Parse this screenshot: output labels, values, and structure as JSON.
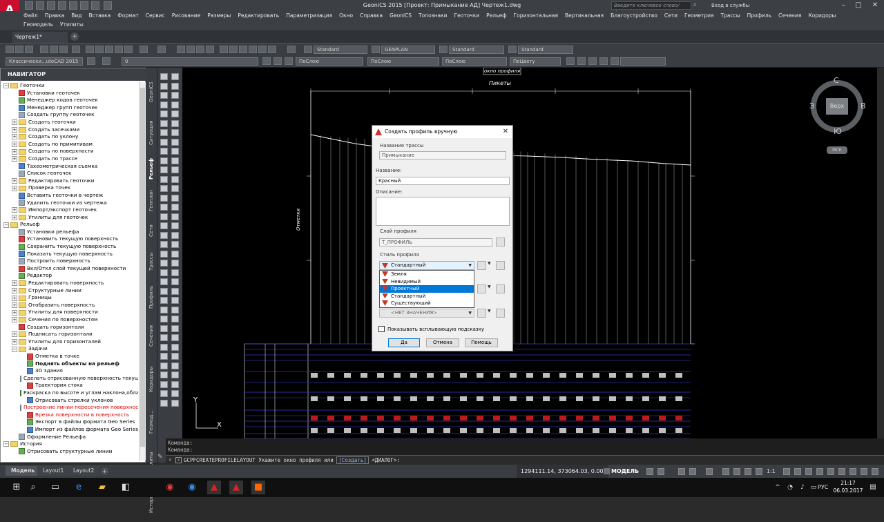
{
  "window": {
    "title": "GeoniCS 2015 [Проект: Примыкание АД]   Чертеж1.dwg",
    "search_placeholder": "Введите ключевое слово/фразу",
    "login": "Вход в службы",
    "app_logo_letter": "A"
  },
  "menu": {
    "row1": [
      "Файл",
      "Правка",
      "Вид",
      "Вставка",
      "Формат",
      "Сервис",
      "Рисование",
      "Размеры",
      "Редактировать",
      "Параметризация",
      "Окно",
      "Справка",
      "GeoniCS",
      "Топознаки",
      "Геоточки",
      "Рельеф",
      "Горизонтальная",
      "Вертикальная",
      "Благоустройство",
      "Сети",
      "Геометрия",
      "Трассы",
      "Профиль",
      "Сечения",
      "Коридоры"
    ],
    "row2": [
      "Геомодель",
      "Утилиты"
    ]
  },
  "file_tab": {
    "label": "Чертеж1*",
    "add_label": "+"
  },
  "toolbar": {
    "text_style": "Standard",
    "dim_style": "GENPLAN",
    "table_style": "Standard",
    "mleader_style": "Standard",
    "workspace": "Классически...utoCAD 2015",
    "layer": "0",
    "color": "ПоСлою",
    "linetype": "ПоСлою",
    "lineweight": "ПоСлою",
    "plotstyle": "ПоЦвету"
  },
  "navigator": {
    "title": "НАВИГАТОР",
    "items": [
      {
        "label": "Геоточки",
        "level": 0,
        "type": "folder",
        "expander": "−"
      },
      {
        "label": "Установки геоточек",
        "level": 1,
        "type": "icon"
      },
      {
        "label": "Менеджер кодов геоточек",
        "level": 1,
        "type": "icon"
      },
      {
        "label": "Менеджер групп геоточек",
        "level": 1,
        "type": "icon"
      },
      {
        "label": "Создать группу геоточек",
        "level": 1,
        "type": "icon"
      },
      {
        "label": "Создать геоточки",
        "level": 1,
        "type": "folder",
        "expander": "+"
      },
      {
        "label": "Создать засечками",
        "level": 1,
        "type": "folder",
        "expander": "+"
      },
      {
        "label": "Создать по уклону",
        "level": 1,
        "type": "folder",
        "expander": "+"
      },
      {
        "label": "Создать по примитивам",
        "level": 1,
        "type": "folder",
        "expander": "+"
      },
      {
        "label": "Создать по поверхности",
        "level": 1,
        "type": "folder",
        "expander": "+"
      },
      {
        "label": "Создать по трассе",
        "level": 1,
        "type": "folder",
        "expander": "+"
      },
      {
        "label": "Тахеометрическая съемка",
        "level": 1,
        "type": "icon"
      },
      {
        "label": "Список геоточек",
        "level": 1,
        "type": "icon"
      },
      {
        "label": "Редактировать геоточки",
        "level": 1,
        "type": "folder",
        "expander": "+"
      },
      {
        "label": "Проверка точек",
        "level": 1,
        "type": "folder",
        "expander": "+"
      },
      {
        "label": "Вставить геоточки в чертеж",
        "level": 1,
        "type": "icon"
      },
      {
        "label": "Удалить геоточки из чертежа",
        "level": 1,
        "type": "icon"
      },
      {
        "label": "Импорт/экспорт геоточек",
        "level": 1,
        "type": "folder",
        "expander": "+"
      },
      {
        "label": "Утилиты для геоточек",
        "level": 1,
        "type": "folder",
        "expander": "+"
      },
      {
        "label": "Рельеф",
        "level": 0,
        "type": "folder",
        "expander": "−"
      },
      {
        "label": "Установки рельефа",
        "level": 1,
        "type": "icon"
      },
      {
        "label": "Установить текущую поверхность",
        "level": 1,
        "type": "icon"
      },
      {
        "label": "Сохранить текущую поверхность",
        "level": 1,
        "type": "icon"
      },
      {
        "label": "Показать текущую поверхность",
        "level": 1,
        "type": "icon"
      },
      {
        "label": "Построить поверхность",
        "level": 1,
        "type": "icon"
      },
      {
        "label": "Вкл/Откл слой текущей поверхности",
        "level": 1,
        "type": "icon"
      },
      {
        "label": "Редактор",
        "level": 1,
        "type": "icon"
      },
      {
        "label": "Редактировать поверхность",
        "level": 1,
        "type": "folder",
        "expander": "+"
      },
      {
        "label": "Структурные линии",
        "level": 1,
        "type": "folder",
        "expander": "+"
      },
      {
        "label": "Границы",
        "level": 1,
        "type": "folder",
        "expander": "+"
      },
      {
        "label": "Отобразить поверхность",
        "level": 1,
        "type": "folder",
        "expander": "+"
      },
      {
        "label": "Утилиты для поверхности",
        "level": 1,
        "type": "folder",
        "expander": "+"
      },
      {
        "label": "Сечения по поверхностям",
        "level": 1,
        "type": "folder",
        "expander": "+"
      },
      {
        "label": "Создать горизонтали",
        "level": 1,
        "type": "icon"
      },
      {
        "label": "Подписать горизонтали",
        "level": 1,
        "type": "folder",
        "expander": "+"
      },
      {
        "label": "Утилиты для горизонталей",
        "level": 1,
        "type": "folder",
        "expander": "+"
      },
      {
        "label": "Задачи",
        "level": 1,
        "type": "folder",
        "expander": "−"
      },
      {
        "label": "Отметка в точке",
        "level": 2,
        "type": "icon"
      },
      {
        "label": "Поднять объекты на рельеф",
        "level": 2,
        "type": "icon",
        "bold": true
      },
      {
        "label": "3D здания",
        "level": 2,
        "type": "icon"
      },
      {
        "label": "Сделать отрисованную поверхность текущей",
        "level": 2,
        "type": "icon"
      },
      {
        "label": "Траектория стока",
        "level": 2,
        "type": "icon"
      },
      {
        "label": "Раскраска по высоте и углам наклона,областей",
        "level": 2,
        "type": "icon"
      },
      {
        "label": "Отрисовать стрелки уклонов",
        "level": 2,
        "type": "icon"
      },
      {
        "label": "Построение линии пересечения поверхностей",
        "level": 2,
        "type": "icon",
        "red": true
      },
      {
        "label": "Врезка поверхности в поверхность",
        "level": 2,
        "type": "icon",
        "red": true
      },
      {
        "label": "Экспорт в файлы формата Geo Series",
        "level": 2,
        "type": "icon"
      },
      {
        "label": "Импорт из файлов формата Geo Series",
        "level": 2,
        "type": "icon"
      },
      {
        "label": "Оформление Рельефа",
        "level": 1,
        "type": "icon"
      },
      {
        "label": "История",
        "level": 0,
        "type": "folder",
        "expander": "−"
      },
      {
        "label": "Отрисовать структурные линии",
        "level": 1,
        "type": "icon"
      }
    ]
  },
  "side_tabs": [
    "GeoniCS",
    "Ситуация",
    "Рельеф",
    "Генплан",
    "Сети",
    "Трассы",
    "Профиль",
    "Сечения",
    "Коридоры",
    "Геомод...",
    "Утилиты",
    "История"
  ],
  "canvas": {
    "annotation_profile_window": "окно профиля",
    "title_pikety": "Пикеты",
    "label_otmetki": "Отметки",
    "ucs_y": "Y",
    "ucs_x": "X"
  },
  "viewcube": {
    "north": "С",
    "south": "Ю",
    "west": "З",
    "east": "В",
    "face": "Верх",
    "wcs": "МСК"
  },
  "dialog": {
    "title": "Создать профиль вручную",
    "route_label": "Название трассы",
    "route_value": "Примыкание",
    "name_label": "Название:",
    "name_value": "Красный",
    "desc_label": "Описание:",
    "desc_value": "",
    "layer_label": "Слой профиля",
    "layer_value": "Т_ПРОФИЛЬ",
    "style_label": "Стиль профиля",
    "style_value": "Стандартный",
    "style_options": [
      "Земля",
      "Невидимый",
      "Проектный",
      "Стандартный",
      "Существующий"
    ],
    "selected_option": "Проектный",
    "third_value": "<НЕТ ЗНАЧЕНИЯ>",
    "checkbox_label": "Показывать всплывающую подсказку",
    "checkbox_checked": true,
    "ok": "Да",
    "cancel": "Отмена",
    "help": "Помощь"
  },
  "command": {
    "history1": "Команда:",
    "history2": "Команда:",
    "prompt_pre": "GCPFCREATEPROFILELAYOUT Укажите окно профиля или ",
    "prompt_keyword": "[Создать]",
    "prompt_post": " <ДИАЛОГ>:"
  },
  "layout_tabs": {
    "model": "Модель",
    "layout1": "Layout1",
    "layout2": "Layout2",
    "add": "+"
  },
  "status": {
    "coords": "1294111.14, 373064.03, 0.00",
    "mode": "МОДЕЛЬ",
    "scale": "1:1"
  },
  "taskbar": {
    "lang": "РУС",
    "time": "21:17",
    "date": "06.03.2017"
  }
}
